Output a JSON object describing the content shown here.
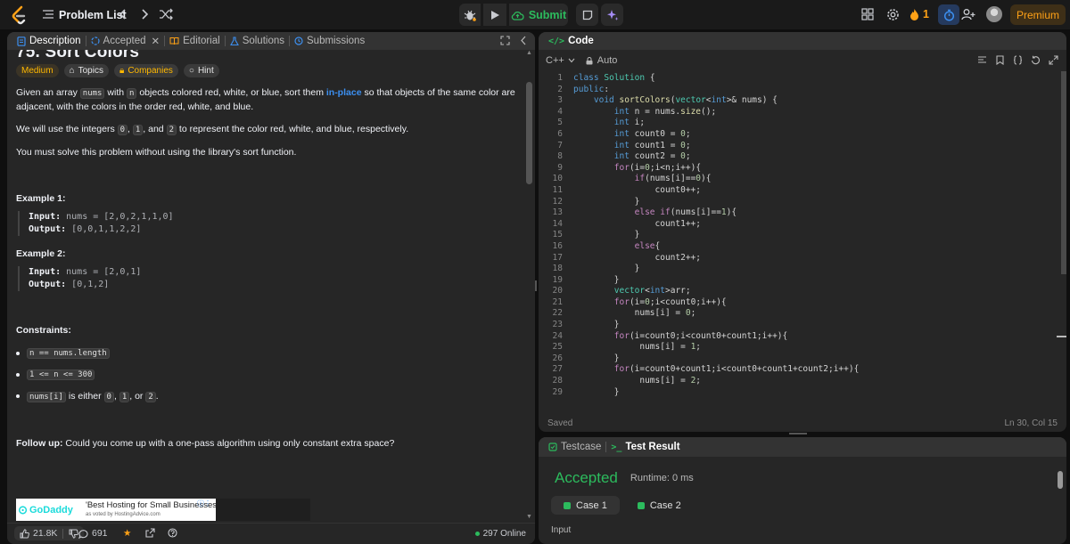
{
  "header": {
    "problem_list_label": "Problem List",
    "submit_label": "Submit",
    "streak_count": "1",
    "premium_label": "Premium"
  },
  "left_panel": {
    "tabs": [
      {
        "label": "Description"
      },
      {
        "label": "Accepted"
      },
      {
        "label": "Editorial"
      },
      {
        "label": "Solutions"
      },
      {
        "label": "Submissions"
      }
    ],
    "title": "75. Sort Colors",
    "chips": {
      "difficulty": "Medium",
      "topics": "Topics",
      "companies": "Companies",
      "hint": "Hint"
    },
    "p1": {
      "a": "Given an array ",
      "code1": "nums",
      "b": " with ",
      "code2": "n",
      "c": " objects colored red, white, or blue, sort them ",
      "inplace": "in-place",
      "d": " so that objects of the same color are adjacent, with the colors in the order red, white, and blue."
    },
    "p2": {
      "a": "We will use the integers ",
      "c0": "0",
      "comma1": ", ",
      "c1": "1",
      "and": ", and ",
      "c2": "2",
      "b": " to represent the color red, white, and blue, respectively."
    },
    "p3": "You must solve this problem without using the library's sort function.",
    "example1": {
      "title": "Example 1:",
      "input_label": "Input:",
      "input": " nums = [2,0,2,1,1,0]",
      "output_label": "Output:",
      "output": " [0,0,1,1,2,2]"
    },
    "example2": {
      "title": "Example 2:",
      "input_label": "Input:",
      "input": " nums = [2,0,1]",
      "output_label": "Output:",
      "output": " [0,1,2]"
    },
    "constraints_title": "Constraints:",
    "constraints": {
      "c1": "n == nums.length",
      "c2": "1 <= n <= 300",
      "c3_code": "nums[i]",
      "c3_a": " is either ",
      "c3_0": "0",
      "c3_comma": ", ",
      "c3_1": "1",
      "c3_or": ", or ",
      "c3_2": "2",
      "c3_end": "."
    },
    "followup_label": "Follow up:",
    "followup_text": " Could you come up with a one-pass algorithm using only constant extra space?",
    "ad": {
      "brand": "GoDaddy",
      "headline": "'Best Hosting for Small Businesses'",
      "sub": "as voted by HostingAdvice.com"
    },
    "footer": {
      "likes": "21.8K",
      "comments": "691",
      "online": "297 Online"
    }
  },
  "code_panel": {
    "title": "Code",
    "language": "C++",
    "mode": "Auto",
    "status_saved": "Saved",
    "cursor": "Ln 30, Col 15",
    "lines": [
      "class Solution {",
      "public:",
      "    void sortColors(vector<int>& nums) {",
      "        int n = nums.size();",
      "        int i;",
      "        int count0 = 0;",
      "        int count1 = 0;",
      "        int count2 = 0;",
      "        for(i=0;i<n;i++){",
      "            if(nums[i]==0){",
      "                count0++;",
      "            }",
      "            else if(nums[i]==1){",
      "                count1++;",
      "            }",
      "            else{",
      "                count2++;",
      "            }",
      "        }",
      "        vector<int>arr;",
      "        for(i=0;i<count0;i++){",
      "            nums[i] = 0;",
      "        }",
      "        for(i=count0;i<count0+count1;i++){",
      "             nums[i] = 1;",
      "        }",
      "        for(i=count0+count1;i<count0+count1+count2;i++){",
      "             nums[i] = 2;",
      "        }"
    ]
  },
  "test_panel": {
    "tabs": [
      {
        "label": "Testcase"
      },
      {
        "label": "Test Result"
      }
    ],
    "result": "Accepted",
    "runtime": "Runtime: 0 ms",
    "cases": [
      {
        "label": "Case 1"
      },
      {
        "label": "Case 2"
      }
    ],
    "input_label": "Input"
  },
  "colors": {
    "accent": "#ffa116",
    "success": "#2cbb5d",
    "link": "#3c8ff0"
  }
}
